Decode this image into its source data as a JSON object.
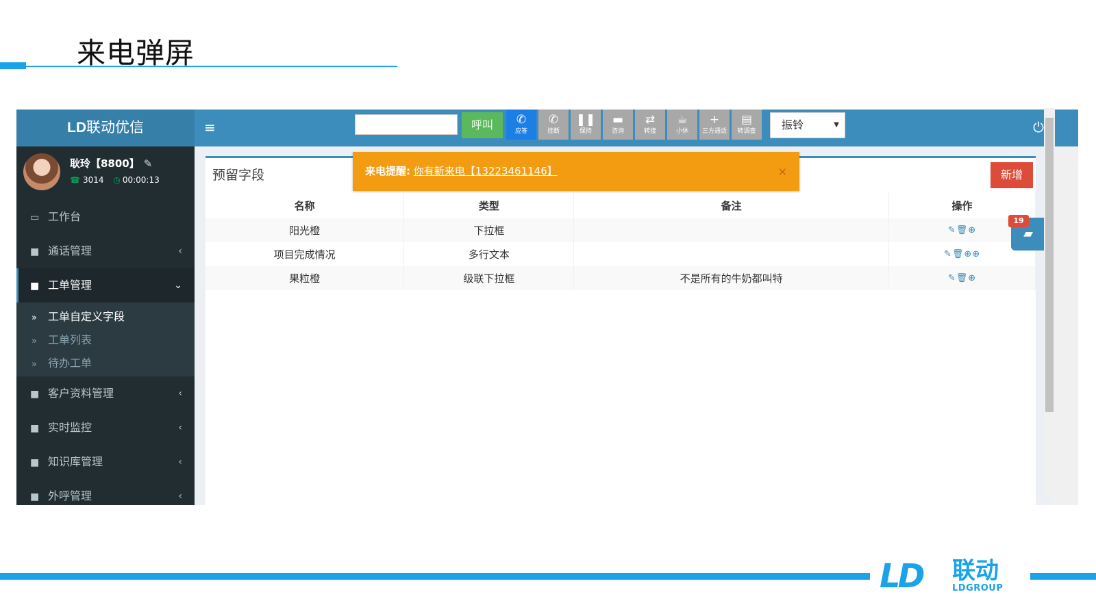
{
  "slide": {
    "title": "来电弹屏"
  },
  "sidebar": {
    "brand_bold": "LD",
    "brand_rest": "联动优信",
    "user": {
      "name": "耿玲【8800】",
      "extension": "3014",
      "timer": "00:00:13"
    },
    "items": [
      {
        "label": "工作台",
        "icon": "desktop-icon"
      },
      {
        "label": "通话管理",
        "icon": "book-icon",
        "chevron": "‹"
      },
      {
        "label": "工单管理",
        "icon": "book-icon",
        "chevron": "⌄"
      },
      {
        "label": "客户资料管理",
        "icon": "book-icon",
        "chevron": "‹"
      },
      {
        "label": "实时监控",
        "icon": "book-icon",
        "chevron": "‹"
      },
      {
        "label": "知识库管理",
        "icon": "book-icon",
        "chevron": "‹"
      },
      {
        "label": "外呼管理",
        "icon": "book-icon",
        "chevron": "‹"
      }
    ],
    "submenu": [
      {
        "label": "工单自定义字段"
      },
      {
        "label": "工单列表"
      },
      {
        "label": "待办工单"
      }
    ]
  },
  "topbar": {
    "call_button": "呼叫",
    "buttons": [
      {
        "label": "应答",
        "icon": "phone-icon"
      },
      {
        "label": "挂断",
        "icon": "hangup-icon"
      },
      {
        "label": "保持",
        "icon": "pause-icon"
      },
      {
        "label": "咨询",
        "icon": "chat-icon"
      },
      {
        "label": "转接",
        "icon": "transfer-icon"
      },
      {
        "label": "小休",
        "icon": "coffee-icon"
      },
      {
        "label": "三方通话",
        "icon": "plus-icon"
      },
      {
        "label": "转调查",
        "icon": "survey-icon"
      }
    ],
    "ring_select": "振铃"
  },
  "alert": {
    "prefix": "来电提醒:",
    "message": "你有新来电【13223461146】",
    "close": "×"
  },
  "panel": {
    "title": "预留字段",
    "add_button": "新增",
    "columns": [
      "名称",
      "类型",
      "备注",
      "操作"
    ],
    "rows": [
      {
        "name": "阳光橙",
        "type": "下拉框",
        "note": "",
        "ops": "✎🗑⊕"
      },
      {
        "name": "项目完成情况",
        "type": "多行文本",
        "note": "",
        "ops": "✎🗑⊕⊕"
      },
      {
        "name": "果粒橙",
        "type": "级联下拉框",
        "note": "不是所有的牛奶都叫特",
        "ops": "✎🗑⊕"
      }
    ]
  },
  "float_badge": "19",
  "logo": {
    "mark": "LD",
    "cn": "联动",
    "en": "LDGROUP"
  },
  "colors": {
    "accent": "#1aa3e8",
    "header": "#3c8dbc",
    "sidebar": "#222d32",
    "alert": "#f39c12",
    "danger": "#dd4b39"
  }
}
